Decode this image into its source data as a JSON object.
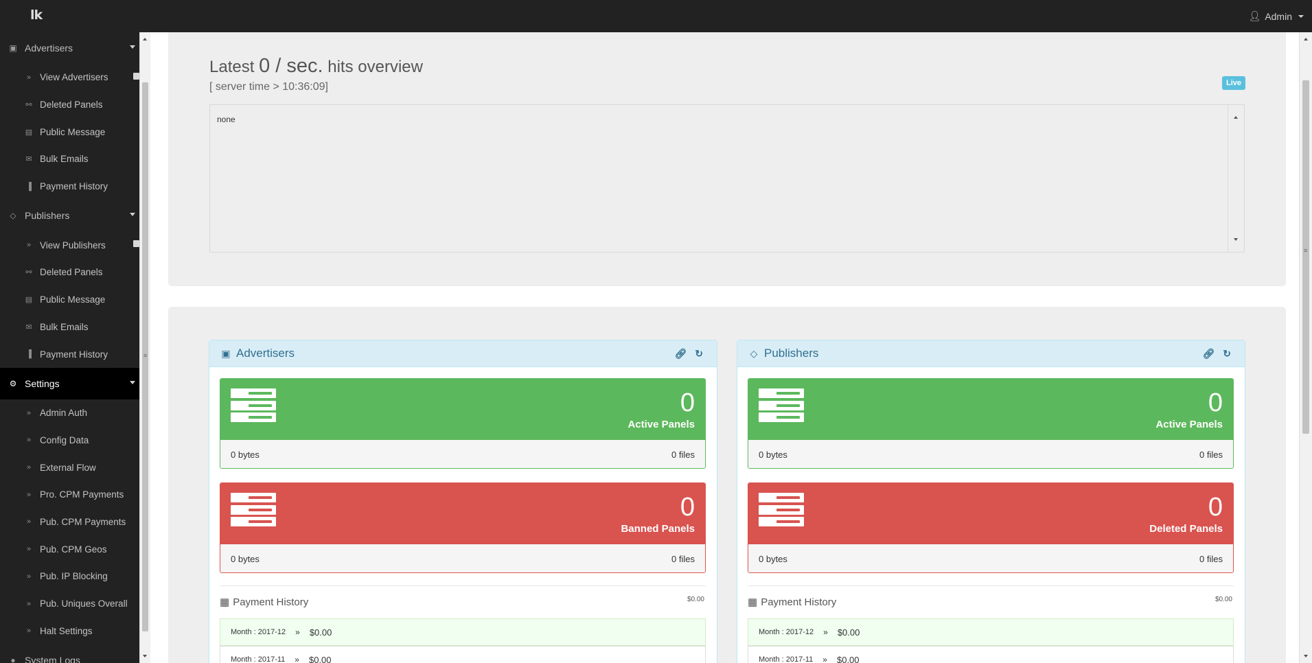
{
  "topbar": {
    "logo": "lk",
    "user_label": "Admin",
    "user_icon": "user-icon"
  },
  "sidebar": {
    "groups": [
      {
        "label": "Advertisers",
        "icon": "cube-icon",
        "items": [
          {
            "label": "View Advertisers",
            "icon": "double-chevron-icon"
          },
          {
            "label": "Deleted Panels",
            "icon": "broken-link-icon"
          },
          {
            "label": "Public Message",
            "icon": "file-icon"
          },
          {
            "label": "Bulk Emails",
            "icon": "envelope-icon"
          },
          {
            "label": "Payment History",
            "icon": "barcode-icon"
          }
        ]
      },
      {
        "label": "Publishers",
        "icon": "diamond-icon",
        "items": [
          {
            "label": "View Publishers",
            "icon": "double-chevron-icon"
          },
          {
            "label": "Deleted Panels",
            "icon": "broken-link-icon"
          },
          {
            "label": "Public Message",
            "icon": "file-icon"
          },
          {
            "label": "Bulk Emails",
            "icon": "envelope-icon"
          },
          {
            "label": "Payment History",
            "icon": "barcode-icon"
          }
        ]
      },
      {
        "label": "Settings",
        "icon": "cogs-icon",
        "items": [
          {
            "label": "Admin Auth"
          },
          {
            "label": "Config Data"
          },
          {
            "label": "External Flow"
          },
          {
            "label": "Pro. CPM Payments"
          },
          {
            "label": "Pub. CPM Payments"
          },
          {
            "label": "Pub. CPM Geos"
          },
          {
            "label": "Pub. IP Blocking"
          },
          {
            "label": "Pub. Uniques Overall"
          },
          {
            "label": "Halt Settings"
          }
        ]
      },
      {
        "label": "System Logs",
        "icon": "globe-icon"
      }
    ]
  },
  "hits": {
    "prefix": "Latest",
    "rate": "0 / sec.",
    "suffix": "hits overview",
    "server_time": "[ server time > 10:36:09]",
    "live_label": "Live",
    "log_text": "none"
  },
  "advertisers": {
    "title": "Advertisers",
    "active": {
      "count": "0",
      "label": "Active Panels",
      "bytes": "0 bytes",
      "files": "0 files"
    },
    "secondary": {
      "count": "0",
      "label": "Banned Panels",
      "bytes": "0 bytes",
      "files": "0 files"
    },
    "payment": {
      "title": "Payment History",
      "total": "$0.00",
      "rows": [
        {
          "month": "Month : 2017-12",
          "arrow": "»",
          "amount": "$0.00"
        },
        {
          "month": "Month : 2017-11",
          "arrow": "»",
          "amount": "$0.00"
        }
      ]
    }
  },
  "publishers": {
    "title": "Publishers",
    "active": {
      "count": "0",
      "label": "Active Panels",
      "bytes": "0 bytes",
      "files": "0 files"
    },
    "secondary": {
      "count": "0",
      "label": "Deleted Panels",
      "bytes": "0 bytes",
      "files": "0 files"
    },
    "payment": {
      "title": "Payment History",
      "total": "$0.00",
      "rows": [
        {
          "month": "Month : 2017-12",
          "arrow": "»",
          "amount": "$0.00"
        },
        {
          "month": "Month : 2017-11",
          "arrow": "»",
          "amount": "$0.00"
        }
      ]
    }
  },
  "colors": {
    "green": "#5cb85c",
    "red": "#d9534f",
    "info": "#5bc0de",
    "panel_head": "#d9edf7",
    "sidebar": "#222222"
  }
}
